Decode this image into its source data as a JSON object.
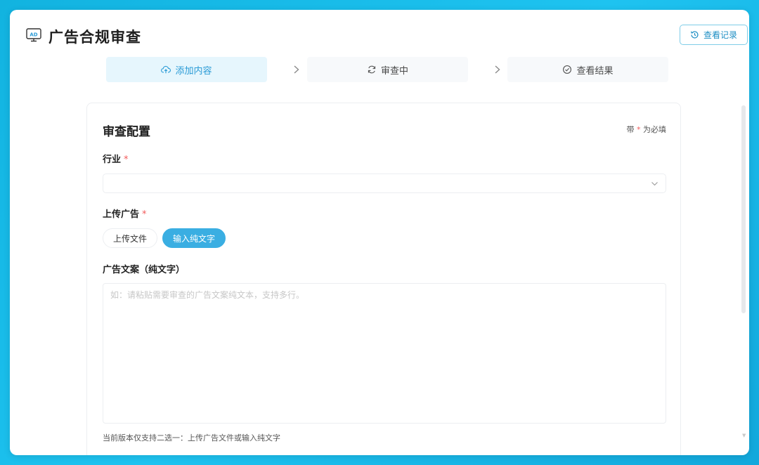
{
  "app": {
    "title": "广告合规审查",
    "icon": "ad-icon",
    "history_button": "查看记录",
    "accent": "#2a9bd6"
  },
  "steps": [
    {
      "label": "添加内容",
      "icon": "cloud-upload-icon",
      "active": true
    },
    {
      "label": "审查中",
      "icon": "refresh-icon",
      "active": false
    },
    {
      "label": "查看结果",
      "icon": "check-circle-icon",
      "active": false
    }
  ],
  "form": {
    "title": "审查配置",
    "required_note_prefix": "带",
    "required_star": "*",
    "required_note_suffix": "为必填",
    "industry": {
      "label": "行业",
      "star": "*",
      "value": ""
    },
    "upload": {
      "label": "上传广告",
      "star": "*",
      "options": [
        "上传文件",
        "输入纯文字"
      ],
      "selected": "输入纯文字"
    },
    "copy": {
      "label": "广告文案（纯文字）",
      "placeholder": "如：请粘贴需要审查的广告文案纯文本，支持多行。",
      "value": ""
    },
    "hint": "当前版本仅支持二选一：上传广告文件或输入纯文字"
  }
}
